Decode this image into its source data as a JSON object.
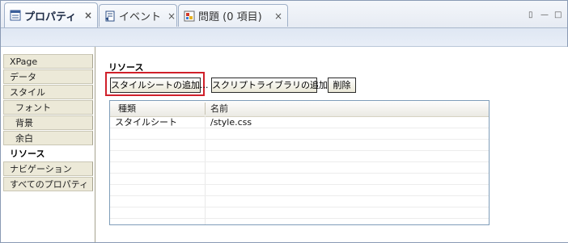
{
  "tabs": [
    {
      "label": "プロパティ",
      "icon": "properties-icon",
      "close": "×",
      "active": true
    },
    {
      "label": "イベント",
      "icon": "events-icon",
      "close": "×",
      "active": false
    },
    {
      "label": "問題 (0 項目)",
      "icon": "problems-icon",
      "close": "×",
      "active": false
    }
  ],
  "view_controls": {
    "menu": "▯",
    "minimize": "—",
    "maximize": "□"
  },
  "sidebar": {
    "items": [
      {
        "label": "XPage"
      },
      {
        "label": "データ"
      },
      {
        "label": "スタイル"
      },
      {
        "label": "フォント"
      },
      {
        "label": "背景"
      },
      {
        "label": "余白"
      },
      {
        "label": "リソース",
        "selected": true
      },
      {
        "label": "ナビゲーション"
      },
      {
        "label": "すべてのプロパティ"
      }
    ]
  },
  "main": {
    "section_title": "リソース",
    "buttons": {
      "add_stylesheet": "スタイルシートの追加...",
      "add_script_library": "スクリプトライブラリの追加...",
      "delete": "削除"
    },
    "table": {
      "columns": [
        "種類",
        "名前"
      ],
      "rows": [
        {
          "type": "スタイルシート",
          "name": "/style.css"
        }
      ]
    }
  },
  "colors": {
    "highlight": "#d0202a",
    "accent": "#8a9ab4"
  }
}
